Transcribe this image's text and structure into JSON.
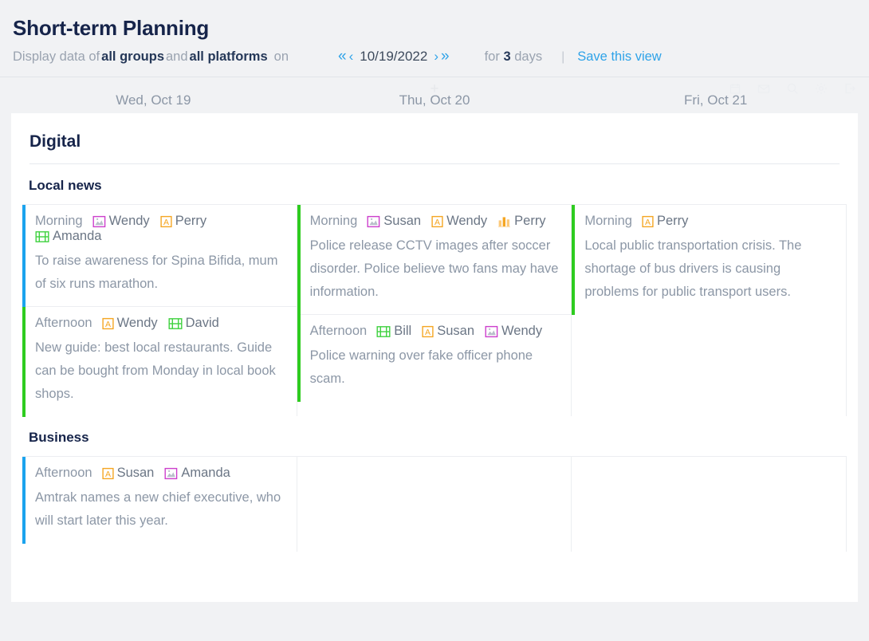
{
  "header": {
    "title": "Short-term Planning",
    "filter_prefix": "Display data of",
    "filter_groups": "all groups",
    "filter_and": "and",
    "filter_platforms": "all platforms",
    "filter_on": "on",
    "date_value": "10/19/2022",
    "nav_first": "«",
    "nav_prev": "‹",
    "nav_next": "›",
    "nav_last": "»",
    "duration_prefix": "for",
    "duration_count": "3",
    "duration_suffix": "days",
    "separator": "|",
    "save_view": "Save this view",
    "add_label": "+"
  },
  "toolbar_icons": [
    {
      "name": "calendar-icon"
    },
    {
      "name": "envelope-icon"
    },
    {
      "name": "search-icon"
    },
    {
      "name": "gear-icon"
    },
    {
      "name": "export-icon"
    }
  ],
  "days": [
    {
      "label": "Wed,  Oct 19"
    },
    {
      "label": "Thu, Oct 20"
    },
    {
      "label": "Fri, Oct 21"
    }
  ],
  "colors": {
    "accent_blue": "#1ba3ee",
    "accent_green": "#2ecc1f",
    "link_blue": "#2fa3e8",
    "title_navy": "#16244a",
    "body_grey": "#8c97a6",
    "icon_image": "#cc3fcc",
    "icon_text": "#f5a623",
    "icon_video": "#3fd13f",
    "icon_chart": "#f5a623"
  },
  "groups": [
    {
      "name": "Digital",
      "sections": [
        {
          "name": "Local news",
          "columns": [
            {
              "cards": [
                {
                  "accent": "blue",
                  "slot": "Morning",
                  "people": [
                    {
                      "icon": "image-icon",
                      "name": "Wendy"
                    },
                    {
                      "icon": "text-icon",
                      "name": "Perry"
                    },
                    {
                      "icon": "video-icon",
                      "name": "Amanda"
                    }
                  ],
                  "body": "To raise awareness for Spina Bifida, mum of six runs marathon."
                },
                {
                  "accent": "green",
                  "slot": "Afternoon",
                  "people": [
                    {
                      "icon": "text-icon",
                      "name": "Wendy"
                    },
                    {
                      "icon": "video-icon",
                      "name": "David"
                    }
                  ],
                  "body": "New guide: best local restaurants. Guide can be bought from Monday in local book shops."
                }
              ]
            },
            {
              "cards": [
                {
                  "accent": "green",
                  "slot": "Morning",
                  "people": [
                    {
                      "icon": "image-icon",
                      "name": "Susan"
                    },
                    {
                      "icon": "text-icon",
                      "name": "Wendy"
                    },
                    {
                      "icon": "chart-icon",
                      "name": "Perry"
                    }
                  ],
                  "body": "Police release CCTV images after soccer disorder. Police believe two fans may have information."
                },
                {
                  "accent": "green",
                  "slot": "Afternoon",
                  "people": [
                    {
                      "icon": "video-icon",
                      "name": "Bill"
                    },
                    {
                      "icon": "text-icon",
                      "name": "Susan"
                    },
                    {
                      "icon": "image-icon",
                      "name": "Wendy"
                    }
                  ],
                  "body": "Police warning over fake officer phone scam."
                }
              ]
            },
            {
              "cards": [
                {
                  "accent": "green",
                  "slot": "Morning",
                  "people": [
                    {
                      "icon": "text-icon",
                      "name": "Perry"
                    }
                  ],
                  "body": "Local public transportation crisis. The shortage of bus drivers is causing problems for public transport users."
                }
              ]
            }
          ]
        },
        {
          "name": "Business",
          "columns": [
            {
              "cards": [
                {
                  "accent": "blue",
                  "slot": "Afternoon",
                  "people": [
                    {
                      "icon": "text-icon",
                      "name": "Susan"
                    },
                    {
                      "icon": "image-icon",
                      "name": "Amanda"
                    }
                  ],
                  "body": "Amtrak names a new chief executive, who will start later this year."
                }
              ]
            },
            {
              "cards": []
            },
            {
              "cards": []
            }
          ]
        }
      ]
    }
  ]
}
